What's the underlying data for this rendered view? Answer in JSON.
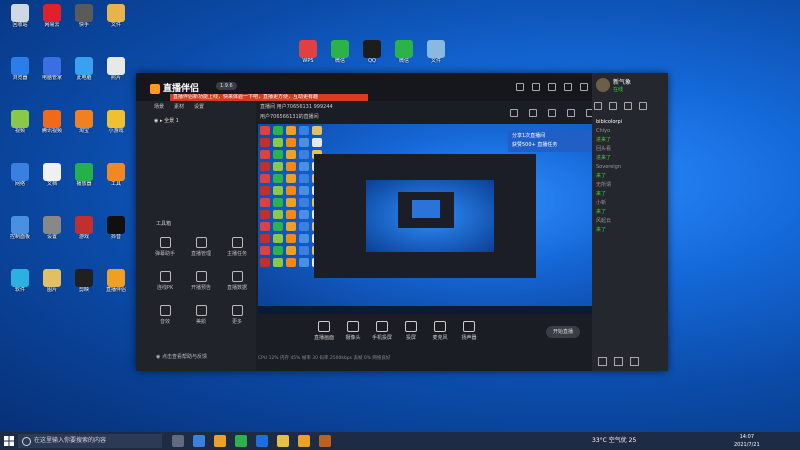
{
  "desktop": {
    "icons": [
      {
        "label": "回收站",
        "color": "#cfd8e3"
      },
      {
        "label": "网易云",
        "color": "#e0202a"
      },
      {
        "label": "快手",
        "color": "#5a5a5a"
      },
      {
        "label": "文件",
        "color": "#e6b44a"
      },
      {
        "label": "浏览器",
        "color": "#2b7de9"
      },
      {
        "label": "电脑管家",
        "color": "#3a6fe0"
      },
      {
        "label": "此电脑",
        "color": "#3aa0f0"
      },
      {
        "label": "照片",
        "color": "#e8e8e8"
      },
      {
        "label": "视频",
        "color": "#8ac84a"
      },
      {
        "label": "腾讯视频",
        "color": "#f06a1a"
      },
      {
        "label": "淘宝",
        "color": "#f08020"
      },
      {
        "label": "小游戏",
        "color": "#f0c030"
      },
      {
        "label": "网络",
        "color": "#3a80e0"
      },
      {
        "label": "文档",
        "color": "#f0f0f0"
      },
      {
        "label": "播放器",
        "color": "#25b04a"
      },
      {
        "label": "工具",
        "color": "#f08a20"
      },
      {
        "label": "控制面板",
        "color": "#4a90e2"
      },
      {
        "label": "设置",
        "color": "#888888"
      },
      {
        "label": "游戏",
        "color": "#c03030"
      },
      {
        "label": "抖音",
        "color": "#101010"
      },
      {
        "label": "软件",
        "color": "#2bb0e0"
      },
      {
        "label": "图片",
        "color": "#e0c060"
      },
      {
        "label": "剪映",
        "color": "#202020"
      },
      {
        "label": "直播伴侣",
        "color": "#f0a020"
      }
    ],
    "top_icons": [
      {
        "label": "WPS",
        "color": "#e04040"
      },
      {
        "label": "微信",
        "color": "#2bb34a"
      },
      {
        "label": "QQ",
        "color": "#1d1d1d"
      },
      {
        "label": "微信",
        "color": "#2bb34a"
      },
      {
        "label": "文件",
        "color": "#8ab8e0"
      }
    ]
  },
  "app": {
    "logo": "直播伴侣",
    "version": "1.9.6",
    "notice": "直播伴侣新功能上线，快来体验一下吧，直播更方便，互动更有趣",
    "left_tabs": [
      "场景",
      "素材",
      "设置"
    ],
    "scene_label": "全景 1",
    "tools_title": "工具箱",
    "tools": [
      {
        "label": "弹幕助手",
        "x": 0
      },
      {
        "label": "直播管理",
        "x": 1
      },
      {
        "label": "主播任务",
        "x": 2
      },
      {
        "label": "连线PK",
        "x": 0
      },
      {
        "label": "开播预告",
        "x": 1
      },
      {
        "label": "直播数据",
        "x": 2
      },
      {
        "label": "音效",
        "x": 0
      },
      {
        "label": "美颜",
        "x": 1
      },
      {
        "label": "更多",
        "x": 2
      }
    ],
    "footer_note": "点击查看帮助与反馈",
    "room": {
      "line1": "直播间 用户70656131 999244",
      "line2": "用户706566131的直播间"
    },
    "preview": {
      "popup_line1": "分享1次直播间",
      "popup_line2": "获赞500+ 直播任务"
    },
    "controls": [
      {
        "label": "直播画面"
      },
      {
        "label": "摄像头"
      },
      {
        "label": "手机投屏"
      },
      {
        "label": "投屏"
      },
      {
        "label": "麦克风"
      },
      {
        "label": "扬声器"
      }
    ],
    "live_button": "开始直播",
    "status": "CPU 12%   内存 45%   帧率 30   码率 2500kbps   丢帧 0%   网络良好",
    "chat": {
      "user": "新气象",
      "online": "在线",
      "items": [
        {
          "name": "bibicolorpi",
          "msg": "",
          "highlight": true
        },
        {
          "name": "Chiyo",
          "msg": "进来了"
        },
        {
          "name": "回头看",
          "msg": "进来了"
        },
        {
          "name": "Sovereign",
          "msg": "来了"
        },
        {
          "name": "无所谓",
          "msg": "来了"
        },
        {
          "name": "小新",
          "msg": "来了"
        },
        {
          "name": "风起云",
          "msg": "来了"
        }
      ]
    }
  },
  "taskbar": {
    "search_placeholder": "在这里输入你要搜索的内容",
    "weather": "33°C 空气优 25",
    "time": "14:07",
    "date": "2021/7/21"
  }
}
